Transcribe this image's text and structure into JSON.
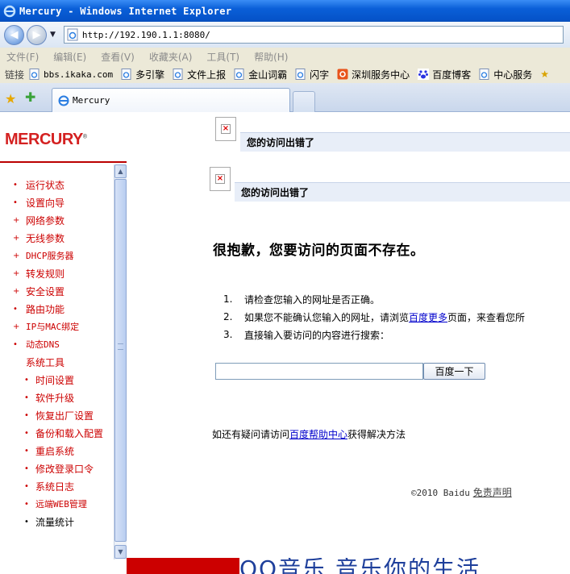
{
  "window": {
    "title": "Mercury - Windows Internet Explorer",
    "url": "http://192.190.1.1:8080/"
  },
  "menubar": {
    "items": [
      "文件(F)",
      "编辑(E)",
      "查看(V)",
      "收藏夹(A)",
      "工具(T)",
      "帮助(H)"
    ]
  },
  "linksbar": {
    "label": "链接",
    "items": [
      "bbs.ikaka.com",
      "多引擎",
      "文件上报",
      "金山词霸",
      "闪字",
      "深圳服务中心",
      "百度博客",
      "中心服务"
    ]
  },
  "tab": {
    "label": "Mercury"
  },
  "logo": {
    "text": "MERCURY",
    "mark": "®"
  },
  "sidebar": {
    "items": [
      {
        "label": "运行状态",
        "bullet": "•"
      },
      {
        "label": "设置向导",
        "bullet": "•"
      },
      {
        "label": "网络参数",
        "bullet": "+"
      },
      {
        "label": "无线参数",
        "bullet": "+"
      },
      {
        "label": "DHCP服务器",
        "bullet": "+"
      },
      {
        "label": "转发规则",
        "bullet": "+"
      },
      {
        "label": "安全设置",
        "bullet": "+"
      },
      {
        "label": "路由功能",
        "bullet": "•"
      },
      {
        "label": "IP与MAC绑定",
        "bullet": "+"
      },
      {
        "label": "动态DNS",
        "bullet": "•"
      },
      {
        "label": "系统工具",
        "bullet": ""
      },
      {
        "label": "时间设置",
        "bullet": "•"
      },
      {
        "label": "软件升级",
        "bullet": "•"
      },
      {
        "label": "恢复出厂设置",
        "bullet": "•"
      },
      {
        "label": "备份和载入配置",
        "bullet": "•"
      },
      {
        "label": "重启系统",
        "bullet": "•"
      },
      {
        "label": "修改登录口令",
        "bullet": "•"
      },
      {
        "label": "系统日志",
        "bullet": "•"
      },
      {
        "label": "远端WEB管理",
        "bullet": "•"
      },
      {
        "label": "流量统计",
        "bullet": "•"
      }
    ]
  },
  "content": {
    "error_title_1": "您的访问出错了",
    "error_title_2": "您的访问出错了",
    "headline": "很抱歉，您要访问的页面不存在。",
    "list": [
      {
        "n": "1.",
        "text": "请检查您输入的网址是否正确。"
      },
      {
        "n": "2.",
        "pre": "如果您不能确认您输入的网址，请浏览",
        "link": "百度更多",
        "post": "页面，来查看您所"
      },
      {
        "n": "3.",
        "text": "直接输入要访问的内容进行搜索："
      }
    ],
    "search_value": "",
    "search_button": "百度一下",
    "help_pre": "如还有疑问请访问",
    "help_link": "百度帮助中心",
    "help_post": "获得解决方法",
    "footer_copy": "©2010 Baidu",
    "footer_link": "免责声明"
  },
  "banner": {
    "text": "QQ音乐  音乐你的生活"
  },
  "colors": {
    "brand": "#d42121",
    "link": "#0000cc",
    "sidebar_text": "#cc0000"
  }
}
